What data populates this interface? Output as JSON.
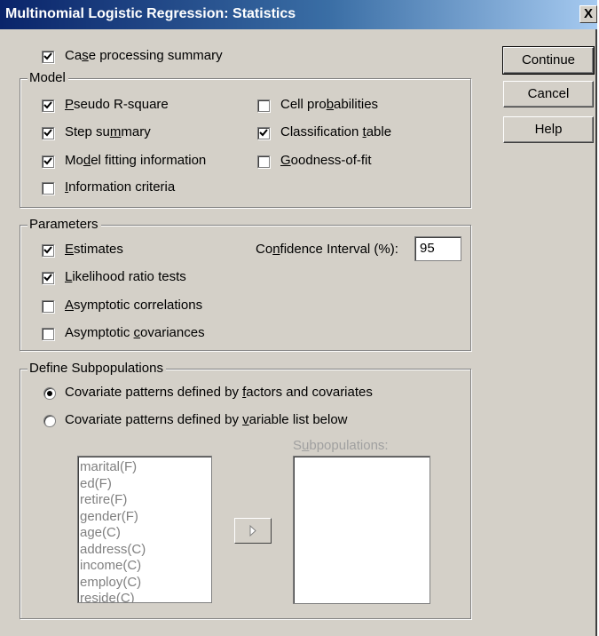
{
  "window": {
    "title": "Multinomial Logistic Regression: Statistics",
    "close_glyph": "X"
  },
  "case_processing": {
    "label_pre": "Ca",
    "label_key": "s",
    "label_post": "e processing summary",
    "checked": true
  },
  "model": {
    "title": "Model",
    "items": [
      {
        "pre": "",
        "key": "P",
        "post": "seudo R-square",
        "checked": true
      },
      {
        "pre": "Step su",
        "key": "m",
        "post": "mary",
        "checked": true
      },
      {
        "pre": "Mo",
        "key": "d",
        "post": "el fitting information",
        "checked": true
      },
      {
        "pre": "",
        "key": "I",
        "post": "nformation criteria",
        "checked": false
      },
      {
        "pre": "Cell pro",
        "key": "b",
        "post": "abilities",
        "checked": false
      },
      {
        "pre": "Classification ",
        "key": "t",
        "post": "able",
        "checked": true
      },
      {
        "pre": "",
        "key": "G",
        "post": "oodness-of-fit",
        "checked": false
      }
    ]
  },
  "parameters": {
    "title": "Parameters",
    "items": [
      {
        "pre": "",
        "key": "E",
        "post": "stimates",
        "checked": true
      },
      {
        "pre": "",
        "key": "L",
        "post": "ikelihood ratio tests",
        "checked": true
      },
      {
        "pre": "",
        "key": "A",
        "post": "symptotic correlations",
        "checked": false
      },
      {
        "pre": "Asymptotic ",
        "key": "c",
        "post": "ovariances",
        "checked": false
      }
    ],
    "ci_label_pre": "Co",
    "ci_label_key": "n",
    "ci_label_post": "fidence Interval (%):",
    "ci_value": "95"
  },
  "subpopulations": {
    "title": "Define Subpopulations",
    "option1_pre": "Covariate patterns defined by ",
    "option1_key": "f",
    "option1_post": "actors and covariates",
    "option1_selected": true,
    "option2_pre": "Covariate patterns defined by ",
    "option2_key": "v",
    "option2_post": "ariable list below",
    "option2_selected": false,
    "variables": [
      "marital(F)",
      "ed(F)",
      "retire(F)",
      "gender(F)",
      "age(C)",
      "address(C)",
      "income(C)",
      "employ(C)",
      "reside(C)"
    ],
    "subpop_label_pre": "S",
    "subpop_label_key": "u",
    "subpop_label_post": "bpopulations:"
  },
  "buttons": {
    "continue": "Continue",
    "cancel": "Cancel",
    "help": "Help"
  },
  "colors": {
    "dialog_bg": "#d4d0c8",
    "title_bar": "#0a246a",
    "disabled_text": "#808080"
  }
}
